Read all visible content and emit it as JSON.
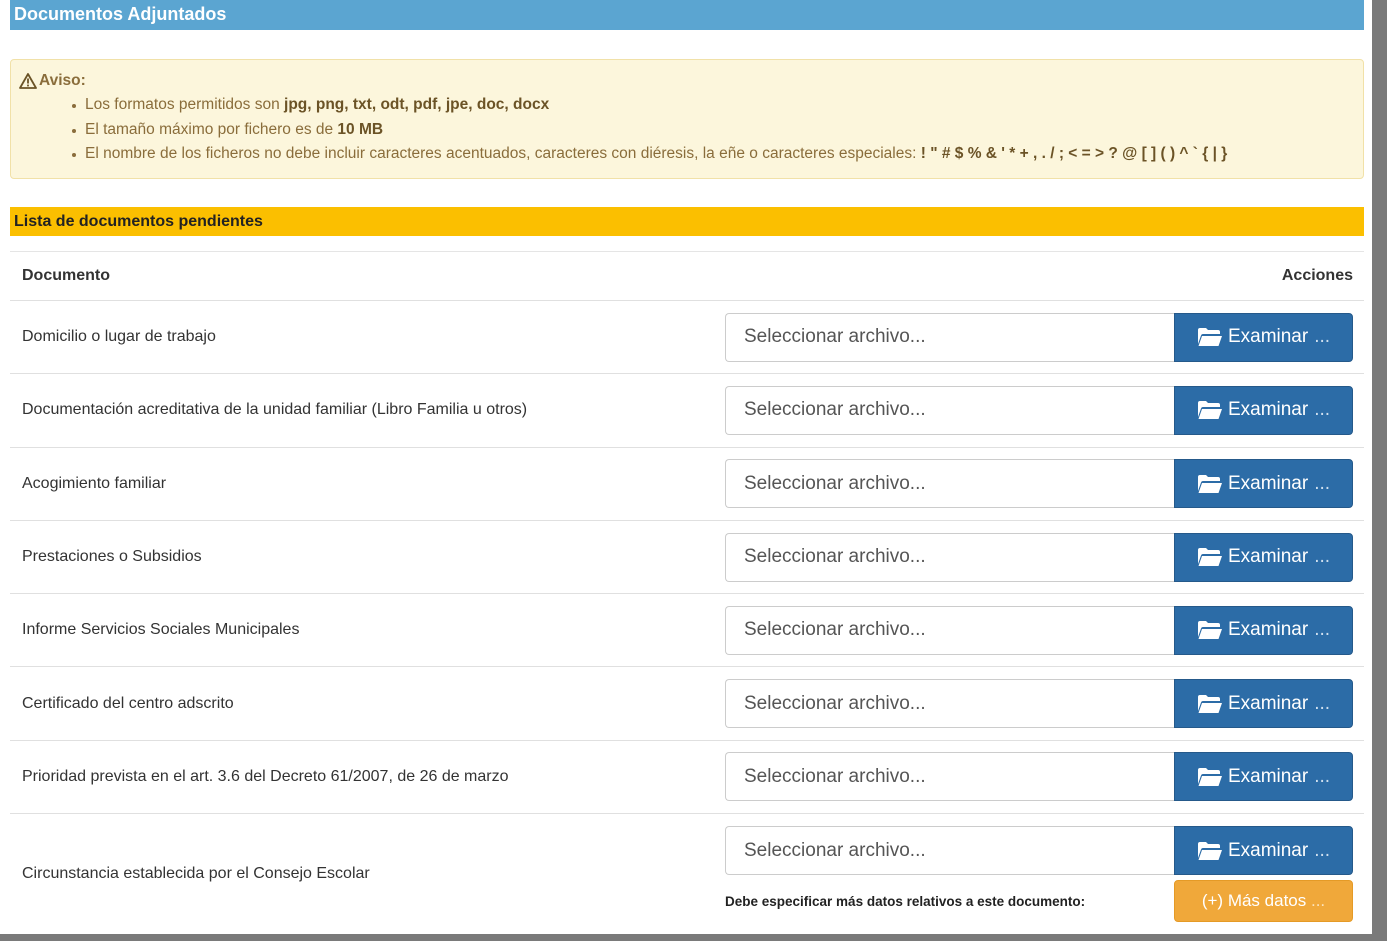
{
  "panel": {
    "title": "Documentos Adjuntados"
  },
  "alert": {
    "title": "Aviso:",
    "item1_prefix": "Los formatos permitidos son ",
    "item1_bold": "jpg, png, txt, odt, pdf, jpe, doc, docx",
    "item2_prefix": "El tamaño máximo por fichero es de ",
    "item2_bold": "10 MB",
    "item3_prefix": "El nombre de los ficheros no debe incluir caracteres acentuados, caracteres con diéresis, la eñe o caracteres especiales: ",
    "item3_bold": "! \" # $ % & ' * + , . / ; < = > ? @ [ ] ( ) ^ ` { | }"
  },
  "list": {
    "title": "Lista de documentos pendientes",
    "col_document": "Documento",
    "col_actions": "Acciones",
    "file_placeholder": "Seleccionar archivo...",
    "browse_label": "Examinar",
    "browse_ellipsis": "...",
    "more_info_label": "Debe especificar más datos relativos a este documento:",
    "more_button_label": "(+) Más datos",
    "more_button_ellipsis": "...",
    "rows": [
      "Domicilio o lugar de trabajo",
      "Documentación acreditativa de la unidad familiar (Libro Familia u otros)",
      "Acogimiento familiar",
      "Prestaciones o Subsidios",
      "Informe Servicios Sociales Municipales",
      "Certificado del centro adscrito",
      "Prioridad prevista en el art. 3.6 del Decreto 61/2007, de 26 de marzo",
      "Circunstancia establecida por el Consejo Escolar"
    ]
  },
  "icons": {
    "warning": "warning-triangle-icon",
    "folder": "folder-open-icon"
  },
  "colors": {
    "header_blue": "#5ba5d1",
    "list_header_yellow": "#fbbf00",
    "alert_bg": "#fcf6dc",
    "browse_blue": "#2c6ca7",
    "more_orange": "#f0a83a"
  }
}
